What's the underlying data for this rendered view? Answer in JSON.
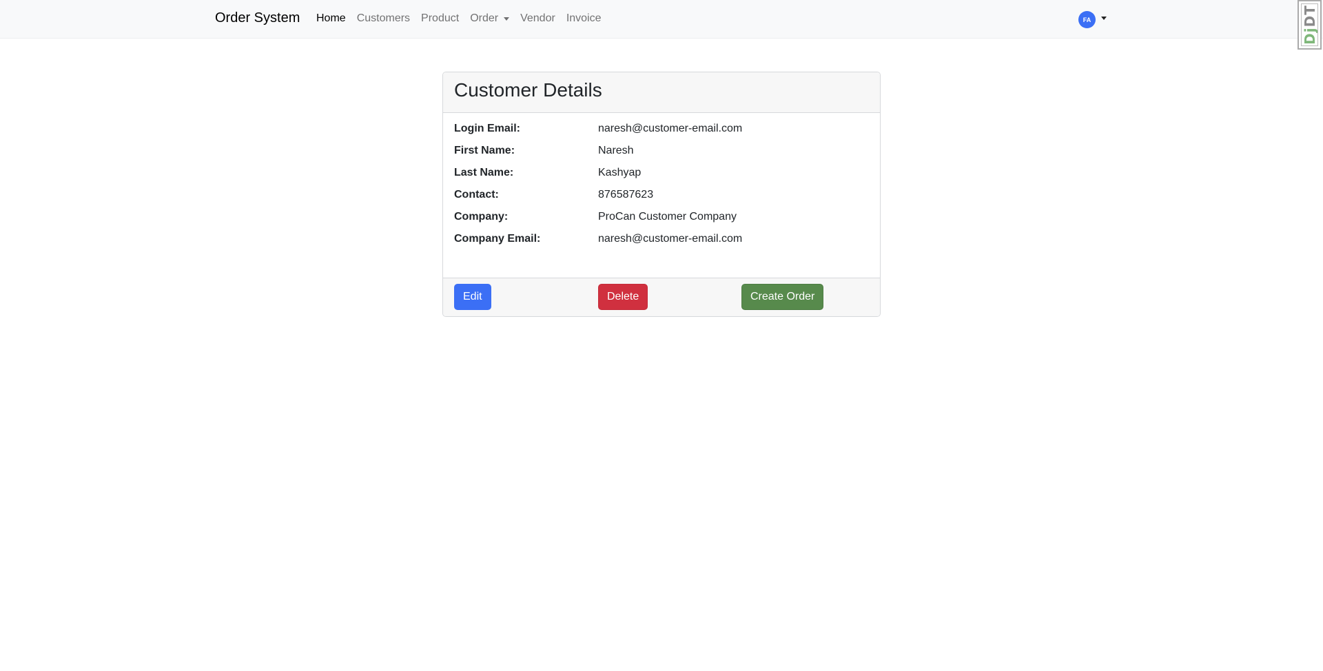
{
  "navbar": {
    "brand": "Order System",
    "links": [
      {
        "label": "Home",
        "active": true
      },
      {
        "label": "Customers"
      },
      {
        "label": "Product"
      },
      {
        "label": "Order",
        "dropdown": true
      },
      {
        "label": "Vendor"
      },
      {
        "label": "Invoice"
      }
    ],
    "user_initials": "FA",
    "avatar_color": "#3b6ff5"
  },
  "debug_toolbar": {
    "label_dj": "Dj",
    "label_dt": "DT"
  },
  "card": {
    "title": "Customer Details",
    "fields": [
      {
        "label": "Login Email:",
        "value": "naresh@customer-email.com"
      },
      {
        "label": "First Name:",
        "value": "Naresh"
      },
      {
        "label": "Last Name:",
        "value": "Kashyap"
      },
      {
        "label": "Contact:",
        "value": "876587623"
      },
      {
        "label": "Company:",
        "value": "ProCan Customer Company"
      },
      {
        "label": "Company Email:",
        "value": "naresh@customer-email.com"
      }
    ],
    "buttons": {
      "edit": "Edit",
      "delete": "Delete",
      "create_order": "Create Order"
    }
  },
  "colors": {
    "edit": "#3b6ff5",
    "delete": "#d0303f",
    "create_order": "#578a4c"
  }
}
